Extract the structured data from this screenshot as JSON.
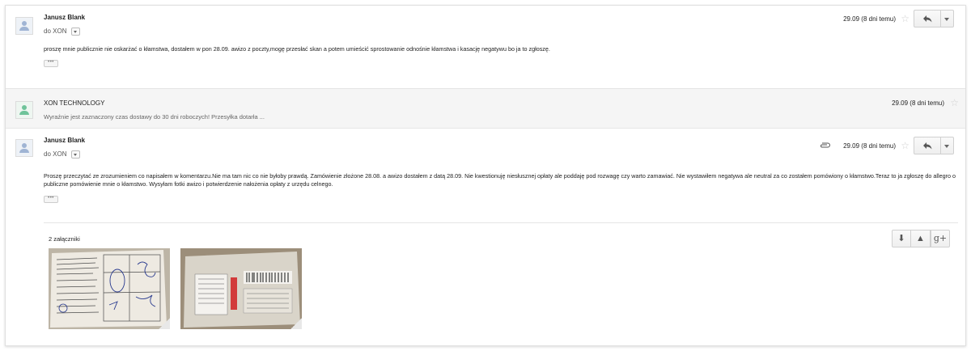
{
  "messages": [
    {
      "sender": "Janusz Blank",
      "sender_hidden": "",
      "recipient_prefix": "do",
      "recipient": "XON",
      "date": "29.09 (8 dni temu)",
      "body": "proszę mnie publicznie nie oskarżać o kłamstwa, dostałem w pon 28.09. awizo z poczty,mogę przesłać skan a potem umieścić sprostowanie odnośnie kłamstwa i kasację negatywu bo ja to zgłoszę."
    },
    {
      "sender": "XON TECHNOLOGY",
      "date": "29.09 (8 dni temu)",
      "snippet": "Wyraźnie jest zaznaczony czas dostawy do 30 dni roboczych! Przesyłka dotarła ..."
    },
    {
      "sender": "Janusz Blank",
      "sender_hidden": "",
      "recipient_prefix": "do",
      "recipient": "XON",
      "date": "29.09 (8 dni temu)",
      "body": "Proszę przeczytać ze zrozumieniem co napisałem w komentarzu.Nie ma tam nic co nie byłoby prawdą. Zamówienie złożone 28.08. a awizo dostałem z datą 28.09. Nie kwestionuję niesłusznej opłaty ale poddaję pod rozwagę czy warto zamawiać. Nie wystawiłem negatywa ale neutral za co zostałem pomówiony o kłamstwo.Teraz to ja zgłoszę do allegro o publiczne pomówienie mnie o kłamstwo. Wysyłam fotki awizo i potwierdzenie nałożenia opłaty z urzędu celnego.",
      "attachments_label": "2 załączniki"
    }
  ],
  "ellipsis": "•••",
  "icons": {
    "star": "☆",
    "download": "⬇",
    "drive": "▲",
    "gplus": "g+"
  },
  "colors": {
    "avatar_person": "#9fb4d4",
    "avatar_company": "#6fc39a",
    "star": "#d0d0d0"
  }
}
